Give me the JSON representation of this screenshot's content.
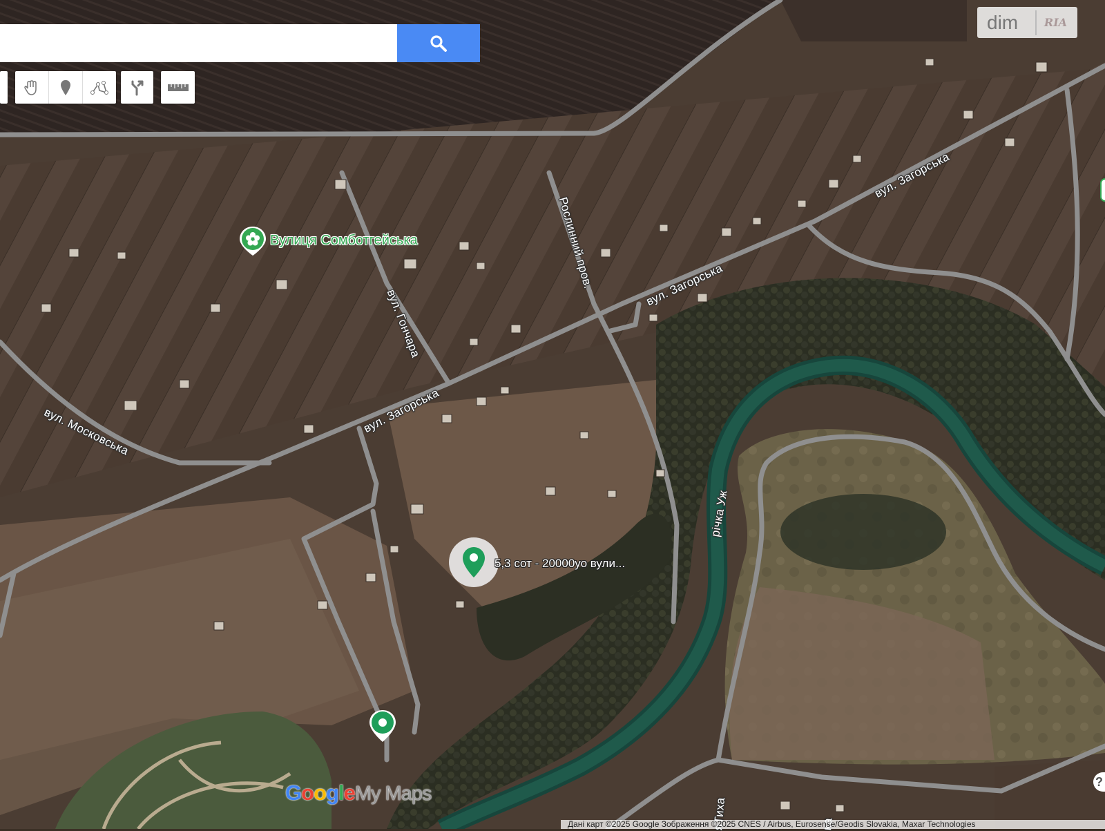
{
  "search": {
    "placeholder": "",
    "value": ""
  },
  "toolbar": {
    "tools": [
      "hand-icon",
      "marker-icon",
      "line-icon",
      "directions-icon"
    ],
    "measure": "ruler-icon"
  },
  "watermark": {
    "brand": "dim",
    "brand2": "RIA"
  },
  "map_labels": {
    "zagorska_1": "вул. Загорська",
    "zagorska_2": "вул. Загорська",
    "zagorska_3": "вул. Загорська",
    "roslynnyi": "Рослинний пров.",
    "honchara": "вул. Гончара",
    "moskovska": "вул. Московська",
    "river": "річка Уж",
    "tykha": "яТиха",
    "ka": "ка"
  },
  "poi": {
    "label": "Вулиця Сомботгейська",
    "icon": "flower-icon",
    "color": "#34a853"
  },
  "selected_pin": {
    "label": "5,3 сот - 20000уо вули...",
    "icon": "pin-icon",
    "color": "#1e9e5a"
  },
  "pin2": {
    "icon": "pin-dot-icon"
  },
  "logo": {
    "google": "Google",
    "mymaps": "My Maps",
    "colors": [
      "#4285f4",
      "#ea4335",
      "#fbbc05",
      "#4285f4",
      "#34a853",
      "#ea4335"
    ]
  },
  "attribution": "Дані карт ©2025 Google Зображення ©2025 CNES / Airbus, Eurosense/Geodis Slovakia, Maxar Technologies"
}
